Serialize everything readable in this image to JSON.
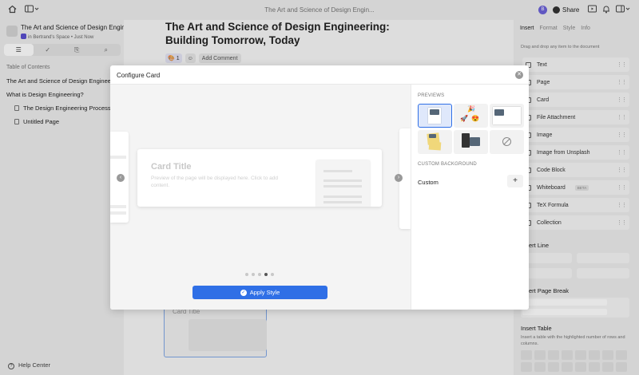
{
  "topbar": {
    "home_icon": "home-icon",
    "sidebar_toggle_icon": "sidebar-toggle-icon",
    "title": "The Art and Science of Design Engin...",
    "avatar_initial": "B",
    "share_label": "Share"
  },
  "sidebar": {
    "workspace_title": "The Art and Science of Design Engineering",
    "workspace_sub": "in Bertrand's Space • Just Now",
    "tabs": [
      "toc-icon",
      "check-icon",
      "attachment-icon",
      "search-icon"
    ],
    "toc_heading": "Table of Contents",
    "toc": [
      {
        "label": "The Art and Science of Design Engineering"
      },
      {
        "label": "What is Design Engineering?"
      },
      {
        "label": "The Design Engineering Process"
      },
      {
        "label": "Untitled Page"
      }
    ],
    "help_label": "Help Center"
  },
  "doc": {
    "title": "The Art and Science of Design Engineering: Building Tomorrow, Today",
    "reaction_count": "1",
    "add_comment": "Add Comment",
    "card_title": "Card Title"
  },
  "right_panel": {
    "tabs": [
      "Insert",
      "Format",
      "Style",
      "Info"
    ],
    "hint": "Drag and drop any item to the document",
    "items": [
      {
        "label": "Text"
      },
      {
        "label": "Page"
      },
      {
        "label": "Card"
      },
      {
        "label": "File Attachment"
      },
      {
        "label": "Image"
      },
      {
        "label": "Image from Unsplash"
      },
      {
        "label": "Code Block"
      },
      {
        "label": "Whiteboard",
        "badge": "BETA"
      },
      {
        "label": "TeX Formula"
      },
      {
        "label": "Collection"
      }
    ],
    "insert_line": "Insert Line",
    "insert_page_break": "Insert Page Break",
    "insert_table": "Insert Table",
    "table_hint": "Insert a table with the highlighted number of rows and columns."
  },
  "modal": {
    "title": "Configure Card",
    "card_title": "Card Title",
    "card_desc": "Preview of the page will be displayed here. Click to add content.",
    "previews_label": "PREVIEWS",
    "custom_bg_label": "CUSTOM BACKGROUND",
    "custom_label": "Custom",
    "plus": "+",
    "apply_label": "Apply Style",
    "pager": {
      "count": 5,
      "active": 4
    }
  }
}
